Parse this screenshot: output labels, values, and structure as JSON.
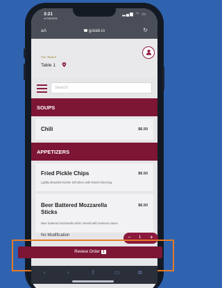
{
  "status": {
    "time": "3:21",
    "back_app": "◂ Camera",
    "signal": "▂▄▆ ◠ ▭"
  },
  "browser": {
    "aa": "aA",
    "url": "gotab.io",
    "reload": "↻"
  },
  "venue": {
    "name": "Tun Tavern",
    "table": "Table 1"
  },
  "search": {
    "placeholder": "Search"
  },
  "sections": [
    {
      "title": "SOUPS"
    },
    {
      "title": "APPETIZERS"
    }
  ],
  "items": [
    {
      "name": "Chili",
      "price": "$6.50",
      "description": ""
    },
    {
      "name": "Fried Pickle Chips",
      "price": "$6.50",
      "description": "Lightly Breaded Kosher Dill Slices with Ranch Dressing"
    },
    {
      "name": "Beer Battered Mozzarella Sticks",
      "price": "$6.50",
      "description": "Beer battered mozzarella sticks served with marinara sauce"
    }
  ],
  "modifier": {
    "label": "No Modification"
  },
  "stepper": {
    "minus": "−",
    "qty": "1",
    "plus": "+"
  },
  "review": {
    "label": "Review Order",
    "count": "1"
  },
  "colors": {
    "brand": "#7d1535",
    "highlight": "#e77a24",
    "background": "#2f63b0"
  },
  "toolbar_icons": [
    "back-icon",
    "forward-icon",
    "share-icon",
    "bookmarks-icon",
    "tabs-icon"
  ]
}
